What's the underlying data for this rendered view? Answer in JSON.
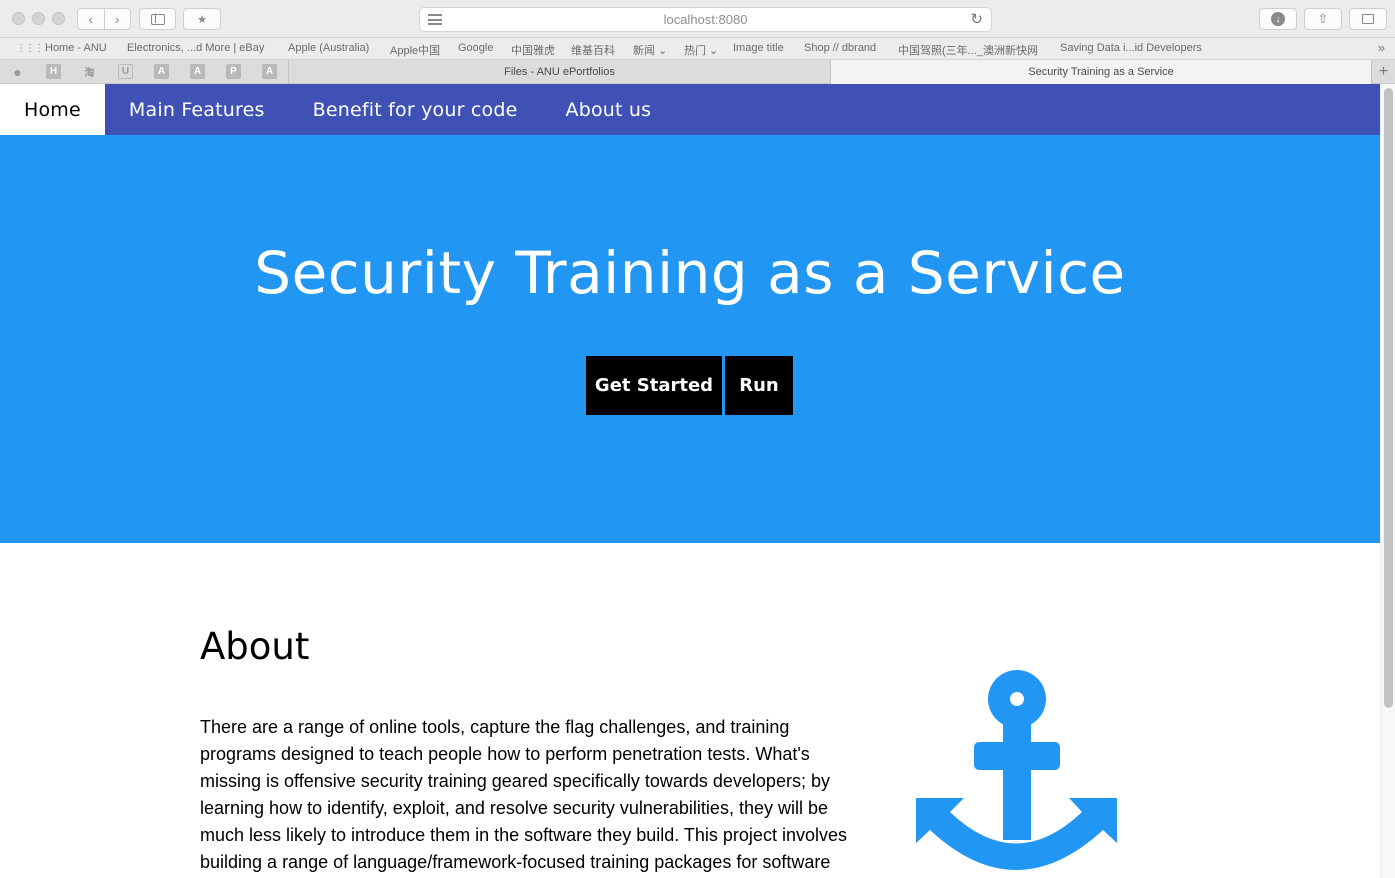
{
  "browser": {
    "url": "localhost:8080",
    "bookmarks": [
      "Home - ANU",
      "Electronics, ...d More | eBay",
      "Apple (Australia)",
      "Apple中国",
      "Google",
      "中国雅虎",
      "维基百科",
      "新闻 ⌄",
      "热门 ⌄",
      "Image title",
      "Shop // dbrand",
      "中国驾照(三年..._澳洲新快网",
      "Saving Data i...id Developers"
    ],
    "pinned_tabs": [
      "",
      "H",
      "淘",
      "U",
      "A",
      "A",
      "P",
      "A"
    ],
    "tabs": [
      {
        "title": "Files - ANU ePortfolios",
        "active": false
      },
      {
        "title": "Security Training as a Service",
        "active": true
      }
    ]
  },
  "nav": {
    "items": [
      "Home",
      "Main Features",
      "Benefit for your code",
      "About us"
    ],
    "active": "Home"
  },
  "hero": {
    "title": "Security Training as a Service",
    "get_started_label": "Get Started",
    "run_label": "Run",
    "background": "#2196f3"
  },
  "about": {
    "heading": "About",
    "body": "There are a range of online tools, capture the flag challenges, and training programs designed to teach people how to perform penetration tests. What's missing is offensive security training geared specifically towards developers; by learning how to identify, exploit, and resolve security vulnerabilities, they will be much less likely to introduce them in the software they build. This project involves building a range of language/framework-focused training packages for software developers, to be",
    "icon": "anchor-icon"
  },
  "colors": {
    "nav": "#3f51b5",
    "accent": "#2196f3",
    "button": "#000000"
  }
}
